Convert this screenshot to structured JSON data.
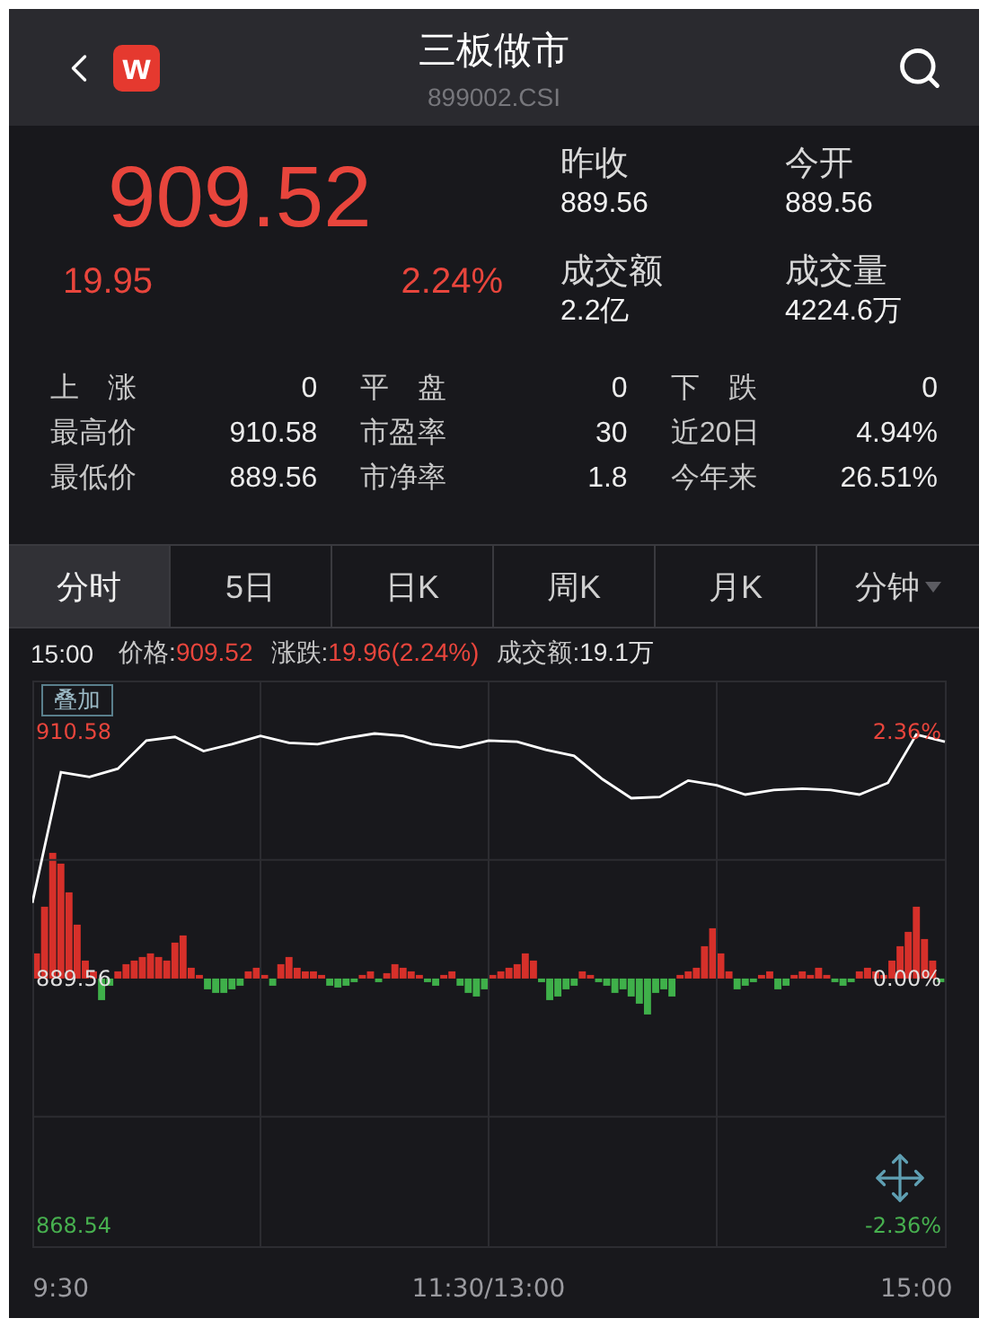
{
  "header": {
    "logo": "w",
    "title": "三板做市",
    "code": "899002.CSI"
  },
  "quote": {
    "price": "909.52",
    "change": "19.95",
    "change_pct": "2.24%",
    "stats": [
      {
        "label": "昨收",
        "value": "889.56"
      },
      {
        "label": "今开",
        "value": "889.56"
      },
      {
        "label": "成交额",
        "value": "2.2亿"
      },
      {
        "label": "成交量",
        "value": "4224.6万"
      }
    ]
  },
  "stats_table": {
    "rows": [
      [
        {
          "label": "上　涨",
          "value": "0"
        },
        {
          "label": "平　盘",
          "value": "0"
        },
        {
          "label": "下　跌",
          "value": "0"
        }
      ],
      [
        {
          "label": "最高价",
          "value": "910.58"
        },
        {
          "label": "市盈率",
          "value": "30"
        },
        {
          "label": "近20日",
          "value": "4.94%"
        }
      ],
      [
        {
          "label": "最低价",
          "value": "889.56"
        },
        {
          "label": "市净率",
          "value": "1.8"
        },
        {
          "label": "今年来",
          "value": "26.51%"
        }
      ]
    ]
  },
  "tabs": [
    {
      "label": "分时",
      "selected": true,
      "kind": "tab"
    },
    {
      "label": "5日",
      "selected": false,
      "kind": "tab"
    },
    {
      "label": "日K",
      "selected": false,
      "kind": "tab"
    },
    {
      "label": "周K",
      "selected": false,
      "kind": "tab"
    },
    {
      "label": "月K",
      "selected": false,
      "kind": "tab"
    },
    {
      "label": "分钟",
      "selected": false,
      "kind": "menu"
    }
  ],
  "info_line": {
    "time": "15:00",
    "items": [
      {
        "label": "价格:",
        "value": "909.52",
        "kind": "up"
      },
      {
        "label": "涨跌:",
        "value": "19.96(2.24%)",
        "kind": "up"
      },
      {
        "label": "成交额:",
        "value": "19.1万",
        "kind": "plain"
      }
    ]
  },
  "chart": {
    "overlay_button": "叠加",
    "percent_labels": [
      "2.36%",
      "0.00%",
      "-2.36%"
    ],
    "chart_data": {
      "type": "line",
      "categories": [
        null,
        "9:30",
        null,
        null,
        null,
        null,
        null,
        null,
        null,
        null,
        null,
        null,
        null,
        null,
        null,
        null,
        "11:30/13:00",
        null,
        null,
        null,
        null,
        null,
        null,
        null,
        null,
        null,
        null,
        null,
        null,
        null,
        null,
        "15:00",
        null
      ],
      "series": [
        {
          "color": "#ffffff",
          "values": [
            896,
            907.1,
            906.7,
            907.4,
            909.8,
            910.1,
            908.9,
            909.5,
            910.2,
            909.6,
            909.5,
            910,
            910.4,
            910.2,
            909.5,
            909.2,
            909.8,
            909.7,
            909,
            908.5,
            906.5,
            904.9,
            905,
            906.4,
            906,
            905.2,
            905.6,
            905.7,
            905.6,
            905.2,
            906.2,
            910.3,
            909.7
          ]
        }
      ],
      "ylim": [
        866.8,
        914.9
      ],
      "grid": true,
      "yticks": [
        {
          "value": 910.58,
          "label": "910.58"
        },
        {
          "value": 889.56,
          "label": "889.56"
        },
        {
          "value": 868.54,
          "label": "868.54"
        }
      ]
    }
  }
}
